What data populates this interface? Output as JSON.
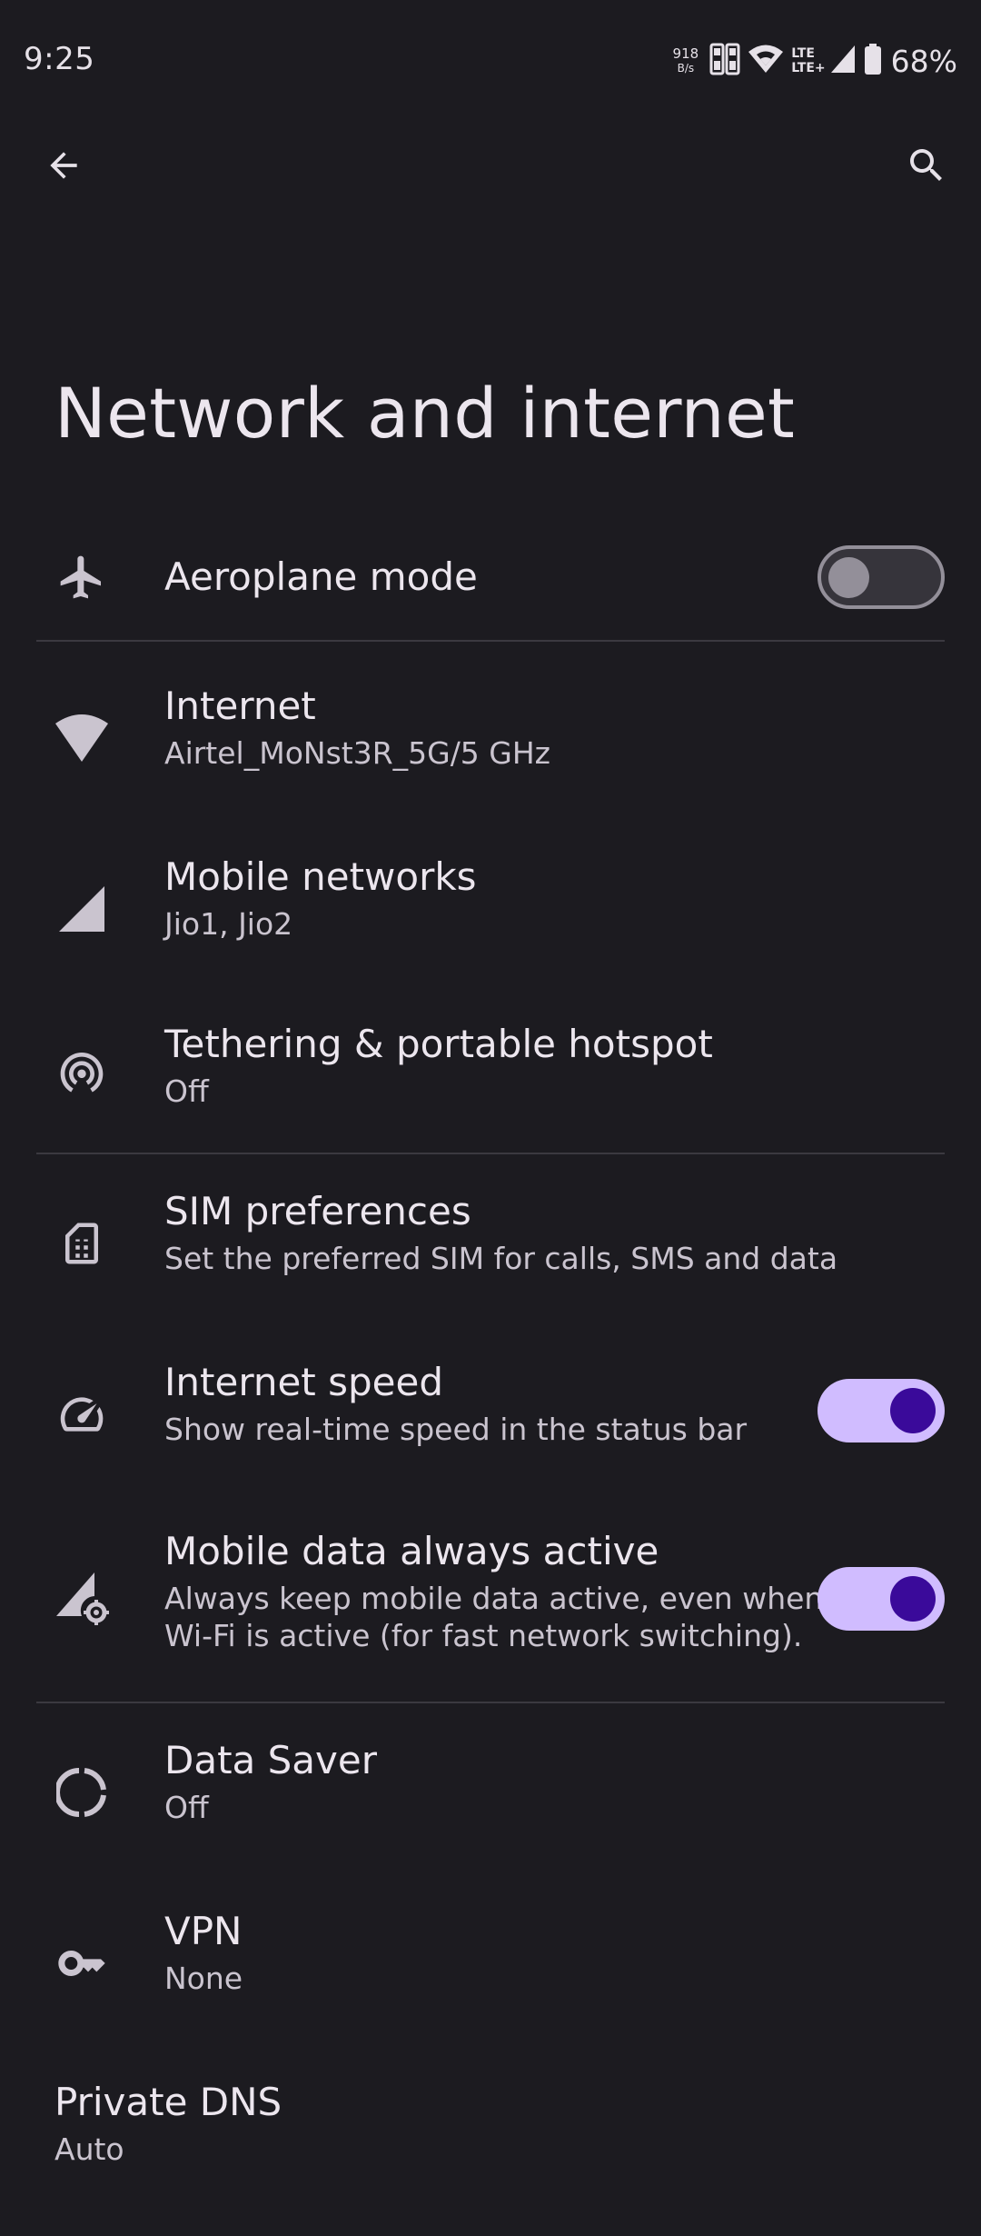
{
  "status_bar": {
    "time": "9:25",
    "net_speed_value": "918",
    "net_speed_unit": "B/s",
    "lte_top": "LTE",
    "lte_bottom": "LTE+",
    "battery": "68%"
  },
  "app_bar": {
    "back_icon": "arrow-back",
    "search_icon": "search"
  },
  "page": {
    "title": "Network and internet"
  },
  "settings": {
    "aeroplane": {
      "title": "Aeroplane mode",
      "icon": "airplane",
      "toggle": "off"
    },
    "internet": {
      "title": "Internet",
      "summary": "Airtel_MoNst3R_5G/5 GHz",
      "icon": "wifi"
    },
    "mobile_networks": {
      "title": "Mobile networks",
      "summary": "Jio1, Jio2",
      "icon": "signal"
    },
    "tethering": {
      "title": "Tethering & portable hotspot",
      "summary": "Off",
      "icon": "hotspot"
    },
    "sim_prefs": {
      "title": "SIM preferences",
      "summary": "Set the preferred SIM for calls, SMS and data",
      "icon": "sim"
    },
    "internet_speed": {
      "title": "Internet speed",
      "summary": "Show real-time speed in the status bar",
      "icon": "speedometer",
      "toggle": "on"
    },
    "mobile_data_active": {
      "title": "Mobile data always active",
      "summary_line1": "Always keep mobile data active, even when",
      "summary_line2": "Wi-Fi is active (for fast network switching).",
      "icon": "signal-settings",
      "toggle": "on"
    },
    "data_saver": {
      "title": "Data Saver",
      "summary": "Off",
      "icon": "data-saver"
    },
    "vpn": {
      "title": "VPN",
      "summary": "None",
      "icon": "key"
    },
    "private_dns": {
      "title": "Private DNS",
      "summary": "Auto"
    }
  },
  "colors": {
    "background": "#1c1b20",
    "switch_on_track": "#d0bcff",
    "switch_on_thumb": "#3a0a9a",
    "switch_off_track": "#36343b",
    "switch_off_outline": "#938f99"
  }
}
